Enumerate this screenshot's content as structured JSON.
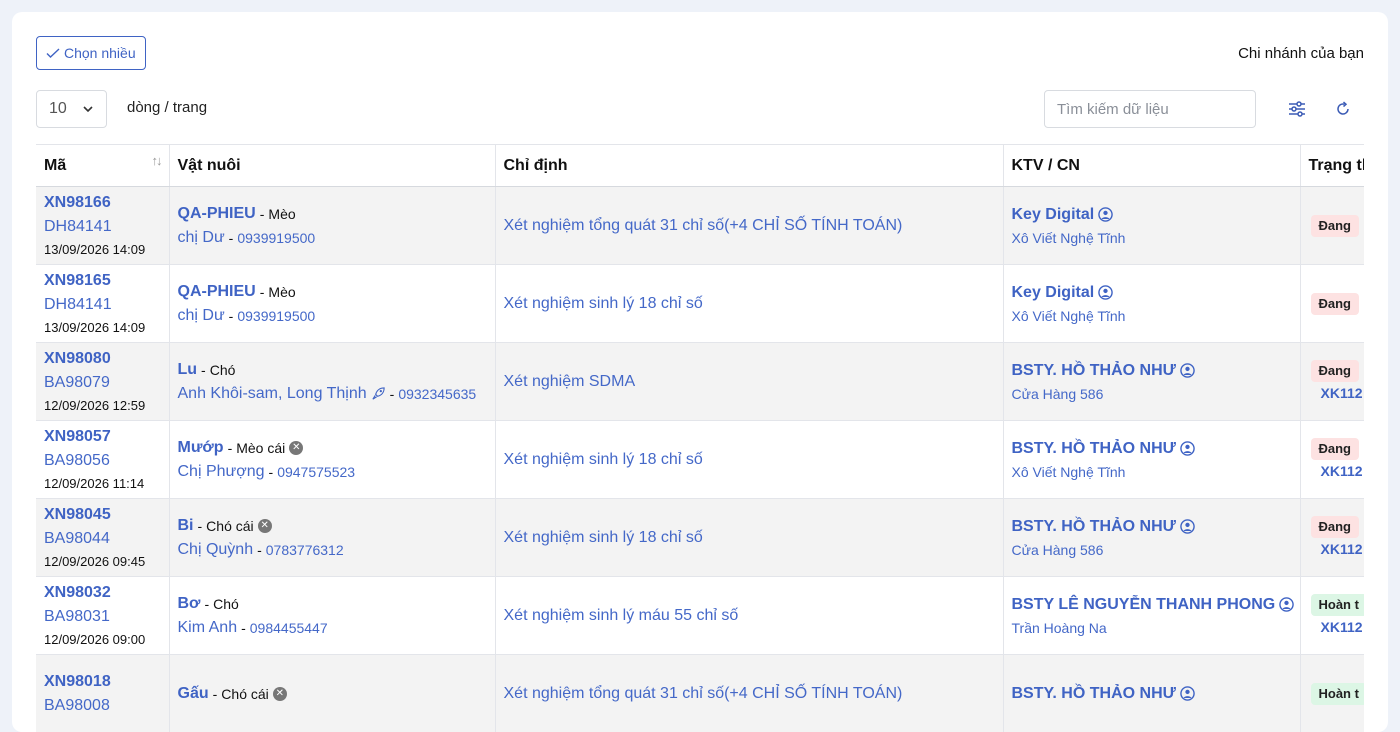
{
  "toolbar": {
    "multi_select_label": "Chọn nhiều",
    "branch_label": "Chi nhánh của bạn",
    "page_size": "10",
    "per_page_label": "dòng / trang",
    "search_placeholder": "Tìm kiếm dữ liệu"
  },
  "table": {
    "headers": [
      "Mã",
      "Vật nuôi",
      "Chỉ định",
      "KTV / CN",
      "Trạng thái"
    ],
    "rows": [
      {
        "code": "XN98166",
        "ref": "DH84141",
        "datetime": "13/09/2026 14:09",
        "pet": "QA-PHIEU",
        "species": "Mèo",
        "owner": "chị Dư",
        "phone": "0939919500",
        "order": "Xét nghiệm tổng quát 31 chỉ số(+4 CHỈ SỐ TÍNH TOÁN)",
        "ktv": "Key Digital",
        "branch": "Xô Viết Nghệ Tĩnh",
        "status": "Đang",
        "xk": ""
      },
      {
        "code": "XN98165",
        "ref": "DH84141",
        "datetime": "13/09/2026 14:09",
        "pet": "QA-PHIEU",
        "species": "Mèo",
        "owner": "chị Dư",
        "phone": "0939919500",
        "order": "Xét nghiệm sinh lý 18 chỉ số",
        "ktv": "Key Digital",
        "branch": "Xô Viết Nghệ Tĩnh",
        "status": "Đang",
        "xk": ""
      },
      {
        "code": "XN98080",
        "ref": "BA98079",
        "datetime": "12/09/2026 12:59",
        "pet": "Lu",
        "species": "Chó",
        "owner": "Anh Khôi-sam, Long Thịnh",
        "phone": "0932345635",
        "order": "Xét nghiệm SDMA",
        "ktv": "BSTY. HỒ THẢO NHƯ",
        "branch": "Cửa Hàng 586",
        "status": "Đang",
        "xk": "XK112"
      },
      {
        "code": "XN98057",
        "ref": "BA98056",
        "datetime": "12/09/2026 11:14",
        "pet": "Mướp",
        "species": "Mèo cái",
        "owner": "Chị Phượng",
        "phone": "0947575523",
        "order": "Xét nghiệm sinh lý 18 chỉ số",
        "ktv": "BSTY. HỒ THẢO NHƯ",
        "branch": "Xô Viết Nghệ Tĩnh",
        "status": "Đang",
        "xk": "XK112"
      },
      {
        "code": "XN98045",
        "ref": "BA98044",
        "datetime": "12/09/2026 09:45",
        "pet": "Bi",
        "species": "Chó cái",
        "owner": "Chị Quỳnh",
        "phone": "0783776312",
        "order": "Xét nghiệm sinh lý 18 chỉ số",
        "ktv": "BSTY. HỒ THẢO NHƯ",
        "branch": "Cửa Hàng 586",
        "status": "Đang",
        "xk": "XK112"
      },
      {
        "code": "XN98032",
        "ref": "BA98031",
        "datetime": "12/09/2026 09:00",
        "pet": "Bơ",
        "species": "Chó",
        "owner": "Kim Anh",
        "phone": "0984455447",
        "order": "Xét nghiệm sinh lý máu 55 chỉ số",
        "ktv": "BSTY LÊ NGUYỄN THANH PHONG",
        "branch": "Trần Hoàng Na",
        "status": "Hoàn t",
        "xk": "XK112"
      },
      {
        "code": "XN98018",
        "ref": "BA98008",
        "datetime": "",
        "pet": "Gấu",
        "species": "Chó cái",
        "owner": "",
        "phone": "",
        "order": "Xét nghiệm tổng quát 31 chỉ số(+4 CHỈ SỐ TÍNH TOÁN)",
        "ktv": "BSTY. HỒ THẢO NHƯ",
        "branch": "",
        "status": "Hoàn t",
        "xk": ""
      }
    ]
  }
}
